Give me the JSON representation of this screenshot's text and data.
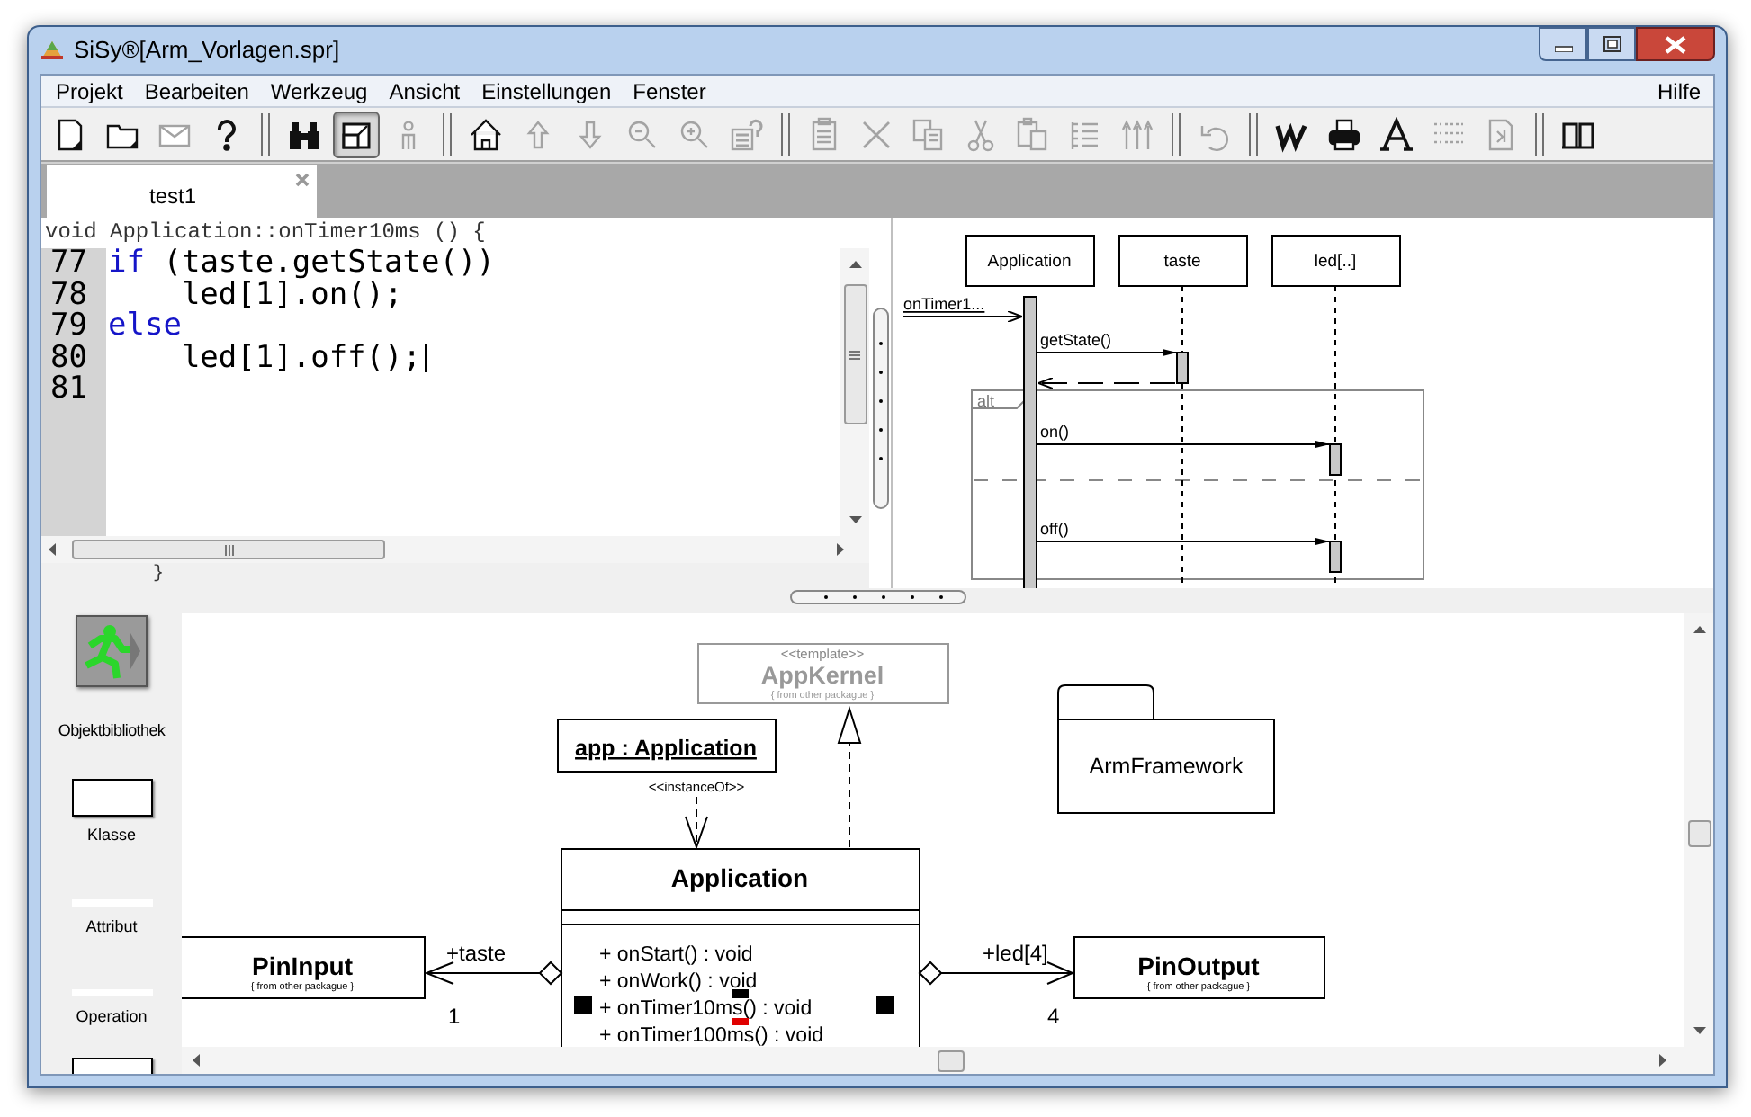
{
  "window": {
    "title": "SiSy®[Arm_Vorlagen.spr]"
  },
  "menu": {
    "items": [
      "Projekt",
      "Bearbeiten",
      "Werkzeug",
      "Ansicht",
      "Einstellungen",
      "Fenster"
    ],
    "right": [
      "Hilfe"
    ]
  },
  "toolbar": [
    {
      "kind": "new-page",
      "disabled": false,
      "pressed": false
    },
    {
      "kind": "folder",
      "disabled": false,
      "pressed": false
    },
    {
      "kind": "mail",
      "disabled": true,
      "pressed": false
    },
    {
      "kind": "help",
      "disabled": false,
      "pressed": false
    },
    {
      "kind": "separator"
    },
    {
      "kind": "find",
      "disabled": false,
      "pressed": false
    },
    {
      "kind": "window",
      "disabled": false,
      "pressed": true
    },
    {
      "kind": "person",
      "disabled": true,
      "pressed": false
    },
    {
      "kind": "separator"
    },
    {
      "kind": "home",
      "disabled": false,
      "pressed": false
    },
    {
      "kind": "up",
      "disabled": true,
      "pressed": false
    },
    {
      "kind": "down",
      "disabled": true,
      "pressed": false
    },
    {
      "kind": "zoom-out",
      "disabled": true,
      "pressed": false
    },
    {
      "kind": "zoom-in",
      "disabled": true,
      "pressed": false
    },
    {
      "kind": "doc-help",
      "disabled": true,
      "pressed": false
    },
    {
      "kind": "separator"
    },
    {
      "kind": "clipboard",
      "disabled": true,
      "pressed": false
    },
    {
      "kind": "delete",
      "disabled": true,
      "pressed": false
    },
    {
      "kind": "copy",
      "disabled": true,
      "pressed": false
    },
    {
      "kind": "cut",
      "disabled": true,
      "pressed": false
    },
    {
      "kind": "paste",
      "disabled": true,
      "pressed": false
    },
    {
      "kind": "list",
      "disabled": true,
      "pressed": false
    },
    {
      "kind": "columns",
      "disabled": true,
      "pressed": false
    },
    {
      "kind": "separator"
    },
    {
      "kind": "undo",
      "disabled": true,
      "pressed": false
    },
    {
      "kind": "separator"
    },
    {
      "kind": "letter-w",
      "disabled": false,
      "pressed": false
    },
    {
      "kind": "print",
      "disabled": false,
      "pressed": false
    },
    {
      "kind": "font",
      "disabled": false,
      "pressed": false
    },
    {
      "kind": "tree",
      "disabled": true,
      "pressed": false
    },
    {
      "kind": "document",
      "disabled": true,
      "pressed": false
    },
    {
      "kind": "separator"
    },
    {
      "kind": "book",
      "disabled": false,
      "pressed": false
    }
  ],
  "tabs": [
    {
      "label": "test1",
      "selected": true
    }
  ],
  "code_editor": {
    "header": "void Application::onTimer10ms () {",
    "lines": [
      {
        "number": "77",
        "caret": false,
        "segments": [
          {
            "text": "if",
            "kind": "keyword"
          },
          {
            "text": " (taste.getState())",
            "kind": "plain"
          }
        ]
      },
      {
        "number": "78",
        "caret": false,
        "segments": [
          {
            "text": "    led[1].on();",
            "kind": "plain"
          }
        ]
      },
      {
        "number": "79",
        "caret": false,
        "segments": [
          {
            "text": "else",
            "kind": "keyword"
          }
        ]
      },
      {
        "number": "80",
        "caret": true,
        "segments": [
          {
            "text": "    led[1].off();",
            "kind": "plain"
          }
        ]
      },
      {
        "number": "81",
        "caret": false
      }
    ],
    "footer": "}"
  },
  "sequence_diagram": {
    "lifelines": [
      "Application",
      "taste",
      "led[..]"
    ],
    "fragment": "alt",
    "messages": [
      {
        "kind": "found",
        "label": "onTimer1..."
      },
      {
        "kind": "call",
        "label": "getState()"
      },
      {
        "kind": "return"
      },
      {
        "kind": "call",
        "label": "on()"
      },
      {
        "kind": "call",
        "label": "off()"
      }
    ]
  },
  "palette": [
    {
      "kind": "library",
      "label": "Objektbibliothek"
    },
    {
      "kind": "class",
      "label": "Klasse"
    },
    {
      "kind": "attribute",
      "label": "Attribut"
    },
    {
      "kind": "operation",
      "label": "Operation"
    },
    {
      "kind": "class"
    }
  ],
  "class_diagram": {
    "template": {
      "stereotype": "<<template>>",
      "name": "AppKernel",
      "note": "{ from other packague }"
    },
    "object": {
      "name": "app : Application",
      "relation": "<<instanceOf>>"
    },
    "package": {
      "name": "ArmFramework"
    },
    "class": {
      "name": "Application",
      "operations": [
        "+ onStart() : void",
        "+ onWork() : void",
        "+ onTimer10ms() : void",
        "+ onTimer100ms() : void"
      ]
    },
    "associations": [
      {
        "role": "+taste",
        "multiplicity": "1",
        "target": {
          "name": "PinInput",
          "note": "{ from other packague }"
        }
      },
      {
        "role": "+led[4]",
        "multiplicity": "4",
        "target": {
          "name": "PinOutput",
          "note": "{ from other packague }"
        }
      }
    ]
  }
}
